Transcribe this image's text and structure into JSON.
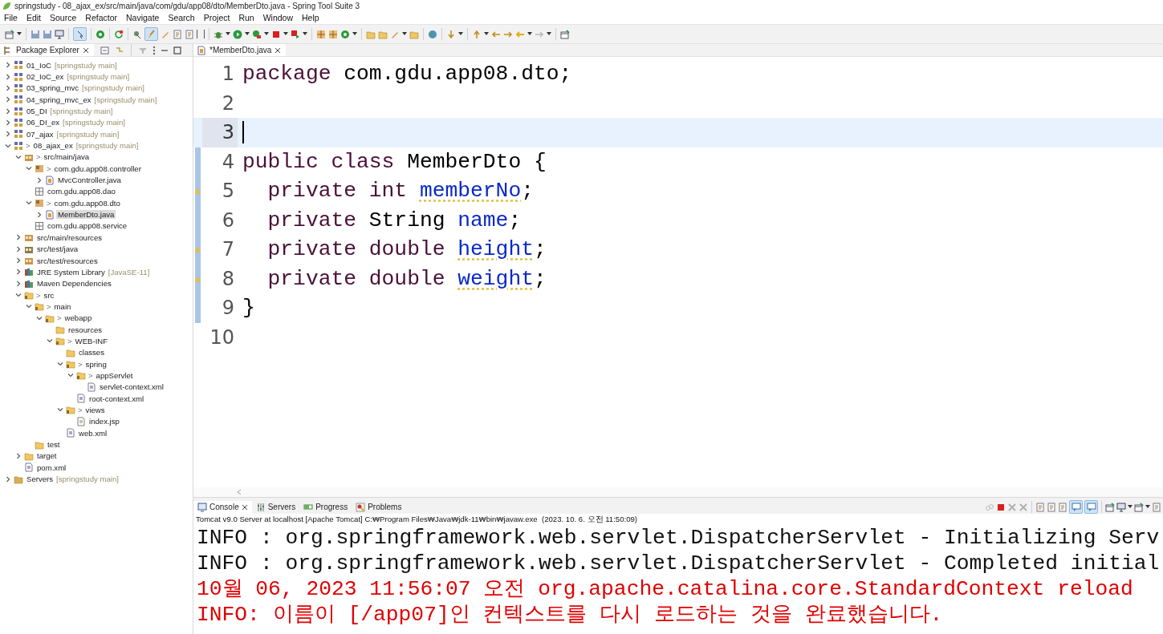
{
  "window": {
    "title": "springstudy - 08_ajax_ex/src/main/java/com/gdu/app08/dto/MemberDto.java - Spring Tool Suite 3"
  },
  "menu": [
    "File",
    "Edit",
    "Source",
    "Refactor",
    "Navigate",
    "Search",
    "Project",
    "Run",
    "Window",
    "Help"
  ],
  "explorer": {
    "tab": {
      "label": "Package Explorer",
      "selected": true
    },
    "items": [
      {
        "kind": "project",
        "label": "01_IoC",
        "decoration": "[springstudy main]",
        "expanded": false,
        "selected": false
      },
      {
        "kind": "project",
        "label": "02_IoC_ex",
        "decoration": "[springstudy main]",
        "expanded": false,
        "selected": false
      },
      {
        "kind": "project",
        "label": "03_spring_mvc",
        "decoration": "[springstudy main]",
        "expanded": false,
        "selected": false
      },
      {
        "kind": "project",
        "label": "04_spring_mvc_ex",
        "decoration": "[springstudy main]",
        "expanded": false,
        "selected": false
      },
      {
        "kind": "project",
        "label": "05_DI",
        "decoration": "[springstudy main]",
        "expanded": false,
        "selected": false
      },
      {
        "kind": "project",
        "label": "06_DI_ex",
        "decoration": "[springstudy main]",
        "expanded": false,
        "selected": false
      },
      {
        "kind": "project",
        "label": "07_ajax",
        "decoration": "[springstudy main]",
        "expanded": false,
        "selected": false
      },
      {
        "kind": "project",
        "prefix": ">",
        "label": "08_ajax_ex",
        "decoration": "[springstudy main]",
        "expanded": true,
        "selected": false,
        "children": [
          {
            "kind": "source_folder",
            "prefix": ">",
            "label": "src/main/java",
            "expanded": true,
            "selected": false,
            "children": [
              {
                "kind": "package",
                "prefix": ">",
                "label": "com.gdu.app08.controller",
                "expanded": true,
                "selected": false,
                "children": [
                  {
                    "kind": "java",
                    "label": "MvcController.java",
                    "expanded": false,
                    "selected": false
                  }
                ]
              },
              {
                "kind": "empty_package",
                "label": "com.gdu.app08.dao",
                "selected": false
              },
              {
                "kind": "package",
                "prefix": ">",
                "label": "com.gdu.app08.dto",
                "expanded": true,
                "selected": false,
                "children": [
                  {
                    "kind": "java",
                    "label": "MemberDto.java",
                    "expanded": false,
                    "selected": true
                  }
                ]
              },
              {
                "kind": "empty_package",
                "label": "com.gdu.app08.service",
                "selected": false
              }
            ]
          },
          {
            "kind": "source_folder",
            "label": "src/main/resources",
            "expanded": false,
            "selected": false
          },
          {
            "kind": "library_folder",
            "label": "src/test/java",
            "expanded": false,
            "selected": false
          },
          {
            "kind": "source_folder",
            "label": "src/test/resources",
            "expanded": false,
            "selected": false
          },
          {
            "kind": "library",
            "label": "JRE System Library",
            "decoration": "[JavaSE-11]",
            "expanded": false,
            "selected": false
          },
          {
            "kind": "library",
            "label": "Maven Dependencies",
            "expanded": false,
            "selected": false
          },
          {
            "kind": "folder_tracked",
            "prefix": ">",
            "label": "src",
            "expanded": true,
            "selected": false,
            "children": [
              {
                "kind": "folder_tracked",
                "prefix": ">",
                "label": "main",
                "expanded": true,
                "selected": false,
                "children": [
                  {
                    "kind": "folder_tracked",
                    "prefix": ">",
                    "label": "webapp",
                    "expanded": true,
                    "selected": false,
                    "children": [
                      {
                        "kind": "folder",
                        "label": "resources",
                        "selected": false
                      },
                      {
                        "kind": "folder_tracked",
                        "prefix": ">",
                        "label": "WEB-INF",
                        "expanded": true,
                        "selected": false,
                        "children": [
                          {
                            "kind": "folder",
                            "label": "classes",
                            "selected": false
                          },
                          {
                            "kind": "folder_tracked",
                            "prefix": ">",
                            "label": "spring",
                            "expanded": true,
                            "selected": false,
                            "children": [
                              {
                                "kind": "folder_tracked",
                                "prefix": ">",
                                "label": "appServlet",
                                "expanded": true,
                                "selected": false,
                                "children": [
                                  {
                                    "kind": "xml",
                                    "label": "servlet-context.xml",
                                    "selected": false
                                  }
                                ]
                              },
                              {
                                "kind": "xml",
                                "label": "root-context.xml",
                                "selected": false
                              }
                            ]
                          },
                          {
                            "kind": "folder_tracked",
                            "prefix": ">",
                            "label": "views",
                            "expanded": true,
                            "selected": false,
                            "children": [
                              {
                                "kind": "jsp",
                                "label": "index.jsp",
                                "selected": false
                              }
                            ]
                          },
                          {
                            "kind": "xml",
                            "label": "web.xml",
                            "selected": false
                          }
                        ]
                      }
                    ]
                  }
                ]
              },
              {
                "kind": "folder_plain",
                "label": "test",
                "selected": false
              }
            ]
          },
          {
            "kind": "folder",
            "label": "target",
            "expanded": false,
            "selected": false
          },
          {
            "kind": "xml",
            "label": "pom.xml",
            "selected": false
          }
        ]
      },
      {
        "kind": "servers",
        "label": "Servers",
        "decoration": "[springstudy main]",
        "expanded": false,
        "selected": false
      }
    ]
  },
  "editor": {
    "tab": {
      "label": "*MemberDto.java",
      "selected": true
    },
    "lines": [
      {
        "number": "1",
        "changed": false,
        "warning": false,
        "current": false,
        "tokens": [
          {
            "kind": "keyword",
            "text": "package"
          },
          {
            "kind": "plain",
            "text": " com.gdu.app08.dto;"
          }
        ]
      },
      {
        "number": "2",
        "changed": false,
        "warning": false,
        "current": false
      },
      {
        "number": "3",
        "changed": false,
        "warning": false,
        "current": true
      },
      {
        "number": "4",
        "changed": true,
        "warning": false,
        "current": false,
        "tokens": [
          {
            "kind": "keyword",
            "text": "public class"
          },
          {
            "kind": "plain",
            "text": " MemberDto {"
          }
        ]
      },
      {
        "number": "5",
        "changed": true,
        "warning": true,
        "current": false,
        "tokens": [
          {
            "kind": "keyword",
            "text": "  private int "
          },
          {
            "kind": "field",
            "text": "memberNo",
            "warning": true
          },
          {
            "kind": "plain",
            "text": ";"
          }
        ]
      },
      {
        "number": "6",
        "changed": true,
        "warning": false,
        "current": false,
        "tokens": [
          {
            "kind": "keyword",
            "text": "  private"
          },
          {
            "kind": "plain",
            "text": " String "
          },
          {
            "kind": "field",
            "text": "name",
            "warning": false
          },
          {
            "kind": "plain",
            "text": ";"
          }
        ]
      },
      {
        "number": "7",
        "changed": true,
        "warning": true,
        "current": false,
        "tokens": [
          {
            "kind": "keyword",
            "text": "  private double "
          },
          {
            "kind": "field",
            "text": "height",
            "warning": true
          },
          {
            "kind": "plain",
            "text": ";"
          }
        ]
      },
      {
        "number": "8",
        "changed": true,
        "warning": true,
        "current": false,
        "tokens": [
          {
            "kind": "keyword",
            "text": "  private double "
          },
          {
            "kind": "field",
            "text": "weight",
            "warning": true
          },
          {
            "kind": "plain",
            "text": ";"
          }
        ]
      },
      {
        "number": "9",
        "changed": true,
        "warning": false,
        "current": false,
        "tokens": [
          {
            "kind": "plain",
            "text": "}"
          }
        ]
      },
      {
        "number": "10",
        "changed": false,
        "warning": false,
        "current": false
      }
    ]
  },
  "bottom_panel": {
    "tabs": [
      {
        "kind": "console",
        "label": "Console",
        "selected": true
      },
      {
        "kind": "servers",
        "label": "Servers",
        "selected": false
      },
      {
        "kind": "progress",
        "label": "Progress",
        "selected": false
      },
      {
        "kind": "problems",
        "label": "Problems",
        "selected": false
      }
    ],
    "description": "Tomcat v9.0 Server at localhost [Apache Tomcat] C:₩Program Files₩Java₩jdk-11₩bin₩javaw.exe  (2023. 10. 6. 오전 11:50:09)",
    "console": [
      {
        "color": "#111111",
        "text": "INFO : org.springframework.web.servlet.DispatcherServlet - Initializing Serv"
      },
      {
        "color": "#111111",
        "text": "INFO : org.springframework.web.servlet.DispatcherServlet - Completed initial"
      },
      {
        "color": "#e00000",
        "text": "10월 06, 2023 11:56:07 오전 org.apache.catalina.core.StandardContext reload"
      },
      {
        "color": "#e00000",
        "text": "INFO: 이름이 [/app07]인 컨텍스트를 다시 로드하는 것을 완료했습니다."
      }
    ]
  }
}
